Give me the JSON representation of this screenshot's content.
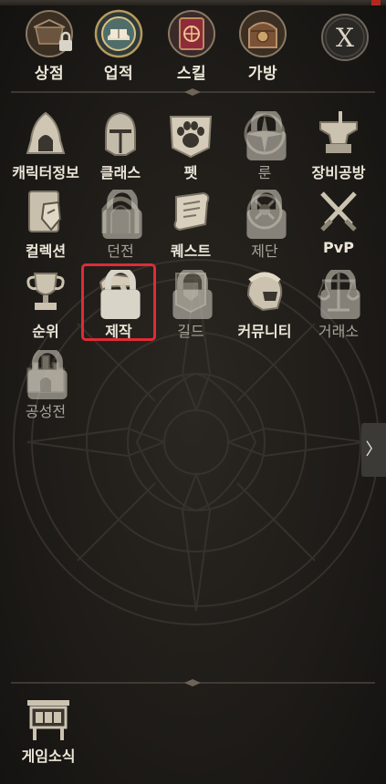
{
  "top_menu": [
    {
      "id": "shop",
      "label": "상점",
      "locked": true
    },
    {
      "id": "achievement",
      "label": "업적",
      "locked": false
    },
    {
      "id": "skill",
      "label": "스킬",
      "locked": false
    },
    {
      "id": "bag",
      "label": "가방",
      "locked": false
    }
  ],
  "close_label": "X",
  "menu_grid": [
    {
      "label": "캐릭터정보",
      "icon": "hood-icon",
      "locked": false
    },
    {
      "label": "클래스",
      "icon": "helmet-icon",
      "locked": false
    },
    {
      "label": "펫",
      "icon": "paw-icon",
      "locked": false
    },
    {
      "label": "룬",
      "icon": "compass-rune-icon",
      "locked": true
    },
    {
      "label": "장비공방",
      "icon": "anvil-icon",
      "locked": false
    },
    {
      "label": "컬렉션",
      "icon": "book-shield-icon",
      "locked": false
    },
    {
      "label": "던전",
      "icon": "portal-gate-icon",
      "locked": true
    },
    {
      "label": "퀘스트",
      "icon": "scroll-icon",
      "locked": false
    },
    {
      "label": "제단",
      "icon": "altar-icon",
      "locked": true
    },
    {
      "label": "PvP",
      "icon": "crossed-swords-icon",
      "locked": false
    },
    {
      "label": "순위",
      "icon": "trophy-icon",
      "locked": false
    },
    {
      "label": "제작",
      "icon": "hammer-icon",
      "locked": true,
      "highlighted": true
    },
    {
      "label": "길드",
      "icon": "banner-icon",
      "locked": true
    },
    {
      "label": "커뮤니티",
      "icon": "spartan-helmet-icon",
      "locked": false
    },
    {
      "label": "거래소",
      "icon": "scales-icon",
      "locked": true
    },
    {
      "label": "공성전",
      "icon": "castle-icon",
      "locked": true
    }
  ],
  "side_tab_glyph": "〉",
  "news": {
    "label": "게임소식",
    "icon": "notice-board-icon"
  },
  "colors": {
    "highlight": "#e02b35",
    "label": "#ece6d8",
    "locked_label": "#a8a398"
  }
}
